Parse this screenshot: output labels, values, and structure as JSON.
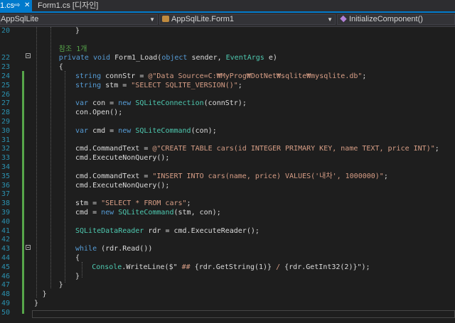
{
  "tabs": [
    {
      "label": "1.cs",
      "pin": "⇨",
      "close": "✕"
    },
    {
      "label": "Form1.cs [디자인]"
    }
  ],
  "nav": {
    "project": "AppSqlLite",
    "class": "AppSqlLite.Form1",
    "member": "InitializeComponent()"
  },
  "references_label": "참조 1개",
  "lines": [
    {
      "n": "20",
      "parts": [
        [
          "p",
          "}"
        ]
      ]
    },
    {
      "n": "",
      "parts": []
    },
    {
      "n": "",
      "parts": [
        [
          "c",
          "참조 1개"
        ]
      ]
    },
    {
      "n": "22",
      "parts": [
        [
          "k",
          "private "
        ],
        [
          "k",
          "void "
        ],
        [
          "p",
          "Form1_Load("
        ],
        [
          "k",
          "object "
        ],
        [
          "p",
          "sender, "
        ],
        [
          "t",
          "EventArgs "
        ],
        [
          "p",
          "e)"
        ]
      ]
    },
    {
      "n": "23",
      "parts": [
        [
          "p",
          "{"
        ]
      ]
    },
    {
      "n": "24",
      "parts": [
        [
          "k",
          "string "
        ],
        [
          "p",
          "connStr = "
        ],
        [
          "s",
          "@\"Data Source=C:₩MyProg₩DotNet₩sqlite₩mysqlite.db\""
        ],
        [
          "p",
          ";"
        ]
      ]
    },
    {
      "n": "25",
      "parts": [
        [
          "k",
          "string "
        ],
        [
          "p",
          "stm = "
        ],
        [
          "s",
          "\"SELECT SQLITE_VERSION()\""
        ],
        [
          "p",
          ";"
        ]
      ]
    },
    {
      "n": "26",
      "parts": []
    },
    {
      "n": "27",
      "parts": [
        [
          "k",
          "var "
        ],
        [
          "p",
          "con = "
        ],
        [
          "k",
          "new "
        ],
        [
          "t",
          "SQLiteConnection"
        ],
        [
          "p",
          "(connStr);"
        ]
      ]
    },
    {
      "n": "28",
      "parts": [
        [
          "p",
          "con.Open();"
        ]
      ]
    },
    {
      "n": "29",
      "parts": []
    },
    {
      "n": "30",
      "parts": [
        [
          "k",
          "var "
        ],
        [
          "p",
          "cmd = "
        ],
        [
          "k",
          "new "
        ],
        [
          "t",
          "SQLiteCommand"
        ],
        [
          "p",
          "(con);"
        ]
      ]
    },
    {
      "n": "31",
      "parts": []
    },
    {
      "n": "32",
      "parts": [
        [
          "p",
          "cmd.CommandText = "
        ],
        [
          "s",
          "@\"CREATE TABLE cars(id INTEGER PRIMARY KEY, name TEXT, price INT)\""
        ],
        [
          "p",
          ";"
        ]
      ]
    },
    {
      "n": "33",
      "parts": [
        [
          "p",
          "cmd.ExecuteNonQuery();"
        ]
      ]
    },
    {
      "n": "34",
      "parts": []
    },
    {
      "n": "35",
      "parts": [
        [
          "p",
          "cmd.CommandText = "
        ],
        [
          "s",
          "\"INSERT INTO cars(name, price) VALUES('내차', 1000000)\""
        ],
        [
          "p",
          ";"
        ]
      ]
    },
    {
      "n": "36",
      "parts": [
        [
          "p",
          "cmd.ExecuteNonQuery();"
        ]
      ]
    },
    {
      "n": "37",
      "parts": []
    },
    {
      "n": "38",
      "parts": [
        [
          "p",
          "stm = "
        ],
        [
          "s",
          "\"SELECT * FROM cars\""
        ],
        [
          "p",
          ";"
        ]
      ]
    },
    {
      "n": "39",
      "parts": [
        [
          "p",
          "cmd = "
        ],
        [
          "k",
          "new "
        ],
        [
          "t",
          "SQLiteCommand"
        ],
        [
          "p",
          "(stm, con);"
        ]
      ]
    },
    {
      "n": "40",
      "parts": []
    },
    {
      "n": "41",
      "parts": [
        [
          "t",
          "SQLiteDataReader "
        ],
        [
          "p",
          "rdr = cmd.ExecuteReader();"
        ]
      ]
    },
    {
      "n": "42",
      "parts": []
    },
    {
      "n": "43",
      "parts": [
        [
          "k",
          "while "
        ],
        [
          "p",
          "(rdr.Read())"
        ]
      ]
    },
    {
      "n": "44",
      "parts": [
        [
          "p",
          "{"
        ]
      ]
    },
    {
      "n": "45",
      "parts": [
        [
          "t",
          "Console"
        ],
        [
          "p",
          ".WriteLine($\" "
        ],
        [
          "s",
          "## "
        ],
        [
          "p",
          "{rdr.GetString(1)} "
        ],
        [
          "s",
          "/ "
        ],
        [
          "p",
          "{rdr.GetInt32(2)}\");"
        ]
      ]
    },
    {
      "n": "46",
      "parts": [
        [
          "p",
          "}"
        ]
      ]
    },
    {
      "n": "47",
      "parts": [
        [
          "p",
          "}"
        ]
      ]
    },
    {
      "n": "48",
      "parts": [
        [
          "p",
          "}"
        ]
      ]
    },
    {
      "n": "49",
      "parts": [
        [
          "p",
          "}"
        ]
      ]
    },
    {
      "n": "50",
      "parts": []
    }
  ],
  "colors": {
    "keyword": "#569cd6",
    "type": "#4ec9b0",
    "string": "#d69d85",
    "lineNumber": "#2b91af",
    "accent": "#007acc"
  }
}
